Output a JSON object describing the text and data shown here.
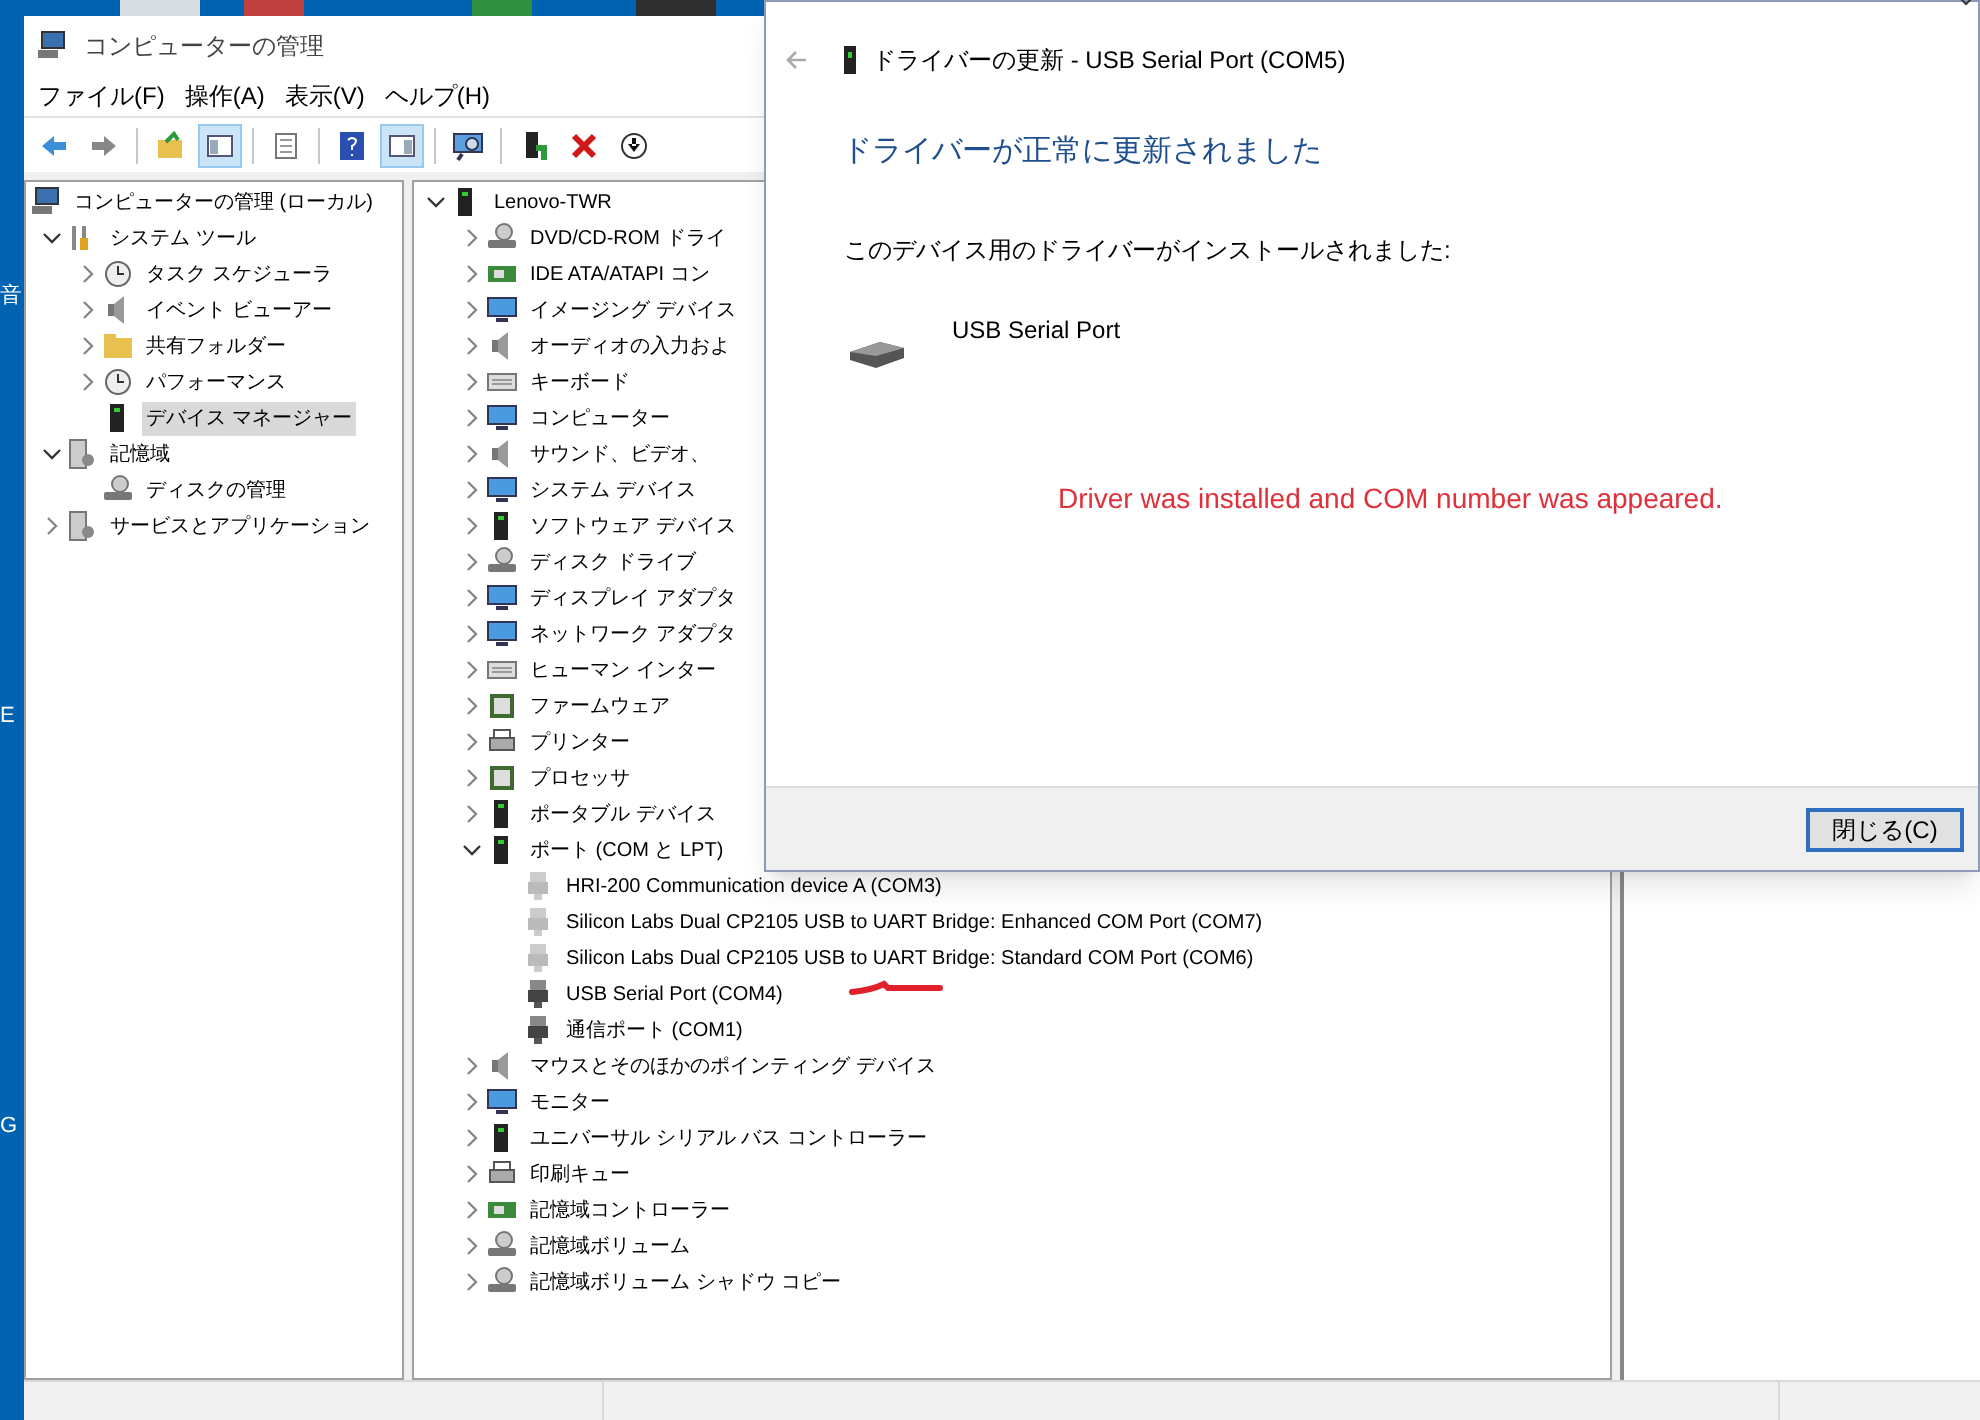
{
  "desktop": {
    "labels": [
      "音",
      "E",
      "G"
    ]
  },
  "window": {
    "title": "コンピューターの管理"
  },
  "menu": [
    "ファイル(F)",
    "操作(A)",
    "表示(V)",
    "ヘルプ(H)"
  ],
  "toolbar": [
    {
      "kind": "button",
      "pressed": false
    },
    {
      "kind": "button",
      "pressed": false
    },
    {
      "kind": "separator"
    },
    {
      "kind": "button",
      "pressed": false
    },
    {
      "kind": "button",
      "pressed": true
    },
    {
      "kind": "separator"
    },
    {
      "kind": "button",
      "pressed": false
    },
    {
      "kind": "separator"
    },
    {
      "kind": "button",
      "pressed": false
    },
    {
      "kind": "button",
      "pressed": true
    },
    {
      "kind": "separator"
    },
    {
      "kind": "button",
      "pressed": false
    },
    {
      "kind": "separator"
    },
    {
      "kind": "button",
      "pressed": false
    },
    {
      "kind": "button",
      "pressed": false
    },
    {
      "kind": "button",
      "pressed": false
    }
  ],
  "left_tree": [
    {
      "label": "コンピューターの管理 (ローカル)",
      "selected": false,
      "children": [
        {
          "label": "システム ツール",
          "expanded": true,
          "selected": false,
          "children": [
            {
              "label": "タスク スケジューラ",
              "expanded": false,
              "selected": false
            },
            {
              "label": "イベント ビューアー",
              "expanded": false,
              "selected": false
            },
            {
              "label": "共有フォルダー",
              "expanded": false,
              "selected": false
            },
            {
              "label": "パフォーマンス",
              "expanded": false,
              "selected": false
            },
            {
              "label": "デバイス マネージャー",
              "selected": true
            }
          ]
        },
        {
          "label": "記憶域",
          "expanded": true,
          "selected": false,
          "children": [
            {
              "label": "ディスクの管理",
              "selected": false
            }
          ]
        },
        {
          "label": "サービスとアプリケーション",
          "expanded": false,
          "selected": false
        }
      ]
    }
  ],
  "device_tree": [
    {
      "label": "Lenovo-TWR",
      "expanded": true,
      "children": [
        {
          "label": "DVD/CD-ROM ドライ",
          "expanded": false
        },
        {
          "label": "IDE ATA/ATAPI コン",
          "expanded": false
        },
        {
          "label": "イメージング デバイス",
          "expanded": false
        },
        {
          "label": "オーディオの入力およ",
          "expanded": false
        },
        {
          "label": "キーボード",
          "expanded": false
        },
        {
          "label": "コンピューター",
          "expanded": false
        },
        {
          "label": "サウンド、ビデオ、",
          "expanded": false
        },
        {
          "label": "システム デバイス",
          "expanded": false
        },
        {
          "label": "ソフトウェア デバイス",
          "expanded": false
        },
        {
          "label": "ディスク ドライブ",
          "expanded": false
        },
        {
          "label": "ディスプレイ アダプタ",
          "expanded": false
        },
        {
          "label": "ネットワーク アダプタ",
          "expanded": false
        },
        {
          "label": "ヒューマン インター",
          "expanded": false
        },
        {
          "label": "ファームウェア",
          "expanded": false
        },
        {
          "label": "プリンター",
          "expanded": false
        },
        {
          "label": "プロセッサ",
          "expanded": false
        },
        {
          "label": "ポータブル デバイス",
          "expanded": false
        },
        {
          "label": "ポート (COM と LPT)",
          "expanded": true,
          "children": [
            {
              "label": "HRI-200 Communication device A (COM3)",
              "disabled": true
            },
            {
              "label": "Silicon Labs Dual CP2105 USB to UART Bridge: Enhanced COM Port (COM7)",
              "disabled": true
            },
            {
              "label": "Silicon Labs Dual CP2105 USB to UART Bridge: Standard COM Port (COM6)",
              "disabled": true
            },
            {
              "label": "USB Serial Port (COM4)",
              "disabled": false
            },
            {
              "label": "通信ポート (COM1)",
              "disabled": false
            }
          ]
        },
        {
          "label": "マウスとそのほかのポインティング デバイス",
          "expanded": false
        },
        {
          "label": "モニター",
          "expanded": false
        },
        {
          "label": "ユニバーサル シリアル バス コントローラー",
          "expanded": false
        },
        {
          "label": "印刷キュー",
          "expanded": false
        },
        {
          "label": "記憶域コントローラー",
          "expanded": false
        },
        {
          "label": "記憶域ボリューム",
          "expanded": false
        },
        {
          "label": "記憶域ボリューム シャドウ コピー",
          "expanded": false
        }
      ]
    }
  ],
  "dialog": {
    "title": "ドライバーの更新 - USB Serial Port (COM5)",
    "heading": "ドライバーが正常に更新されました",
    "message": "このデバイス用のドライバーがインストールされました:",
    "device": "USB Serial Port",
    "annotation": "Driver was installed and COM number was appeared.",
    "close_button": "閉じる(C)"
  }
}
